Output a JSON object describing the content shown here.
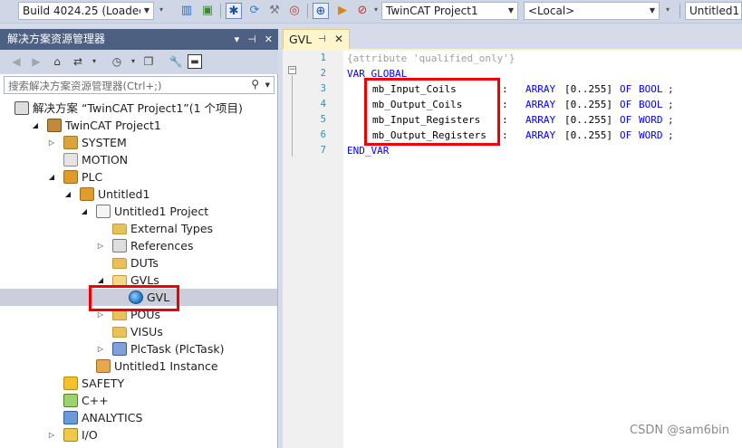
{
  "toolbar": {
    "build_combo": "Build 4024.25 (Loaded",
    "project_combo": "TwinCAT Project1",
    "target_combo": "<Local>",
    "plc_combo": "Untitled1"
  },
  "solution_explorer": {
    "title": "解决方案资源管理器",
    "search_placeholder": "搜索解决方案资源管理器(Ctrl+;)",
    "tree": [
      {
        "label": "解决方案 “TwinCAT Project1”(1 个项目)",
        "depth": 0,
        "expander": "",
        "icon": "solution-icon"
      },
      {
        "label": "TwinCAT Project1",
        "depth": 1,
        "expander": "open",
        "icon": "twincat-project-icon"
      },
      {
        "label": "SYSTEM",
        "depth": 2,
        "expander": "closed",
        "icon": "system-icon"
      },
      {
        "label": "MOTION",
        "depth": 2,
        "expander": "",
        "icon": "motion-icon"
      },
      {
        "label": "PLC",
        "depth": 2,
        "expander": "open",
        "icon": "plc-icon"
      },
      {
        "label": "Untitled1",
        "depth": 3,
        "expander": "open",
        "icon": "plc-project-icon"
      },
      {
        "label": "Untitled1 Project",
        "depth": 4,
        "expander": "open",
        "icon": "project-doc-icon"
      },
      {
        "label": "External Types",
        "depth": 5,
        "expander": "",
        "icon": "folder-icon"
      },
      {
        "label": "References",
        "depth": 5,
        "expander": "closed",
        "icon": "references-icon"
      },
      {
        "label": "DUTs",
        "depth": 5,
        "expander": "",
        "icon": "folder-icon"
      },
      {
        "label": "GVLs",
        "depth": 5,
        "expander": "open",
        "icon": "folder-open-icon"
      },
      {
        "label": "GVL",
        "depth": 6,
        "expander": "",
        "icon": "gvl-globe-icon",
        "selected": true
      },
      {
        "label": "POUs",
        "depth": 5,
        "expander": "closed",
        "icon": "folder-icon"
      },
      {
        "label": "VISUs",
        "depth": 5,
        "expander": "",
        "icon": "folder-icon"
      },
      {
        "label": "PlcTask (PlcTask)",
        "depth": 5,
        "expander": "closed",
        "icon": "task-icon"
      },
      {
        "label": "Untitled1 Instance",
        "depth": 4,
        "expander": "",
        "icon": "instance-icon"
      },
      {
        "label": "SAFETY",
        "depth": 2,
        "expander": "",
        "icon": "safety-icon"
      },
      {
        "label": "C++",
        "depth": 2,
        "expander": "",
        "icon": "cpp-icon"
      },
      {
        "label": "ANALYTICS",
        "depth": 2,
        "expander": "",
        "icon": "analytics-icon"
      },
      {
        "label": "I/O",
        "depth": 2,
        "expander": "closed",
        "icon": "io-icon"
      }
    ]
  },
  "editor": {
    "tab_label": "GVL",
    "line_numbers": [
      "1",
      "2",
      "3",
      "4",
      "5",
      "6",
      "7"
    ],
    "lines": [
      {
        "attr": "{attribute 'qualified_only'}"
      },
      {
        "kw": "VAR_GLOBAL"
      },
      {
        "name": "mb_Input_Coils",
        "type": "BOOL"
      },
      {
        "name": "mb_Output_Coils",
        "type": "BOOL"
      },
      {
        "name": "mb_Input_Registers",
        "type": "WORD"
      },
      {
        "name": "mb_Output_Registers",
        "type": "WORD"
      },
      {
        "kw": "END_VAR"
      }
    ],
    "array_kw": "ARRAY",
    "range": "[0..255]",
    "of_kw": "OF",
    "colon": ":"
  },
  "watermark": "CSDN @sam6bin"
}
